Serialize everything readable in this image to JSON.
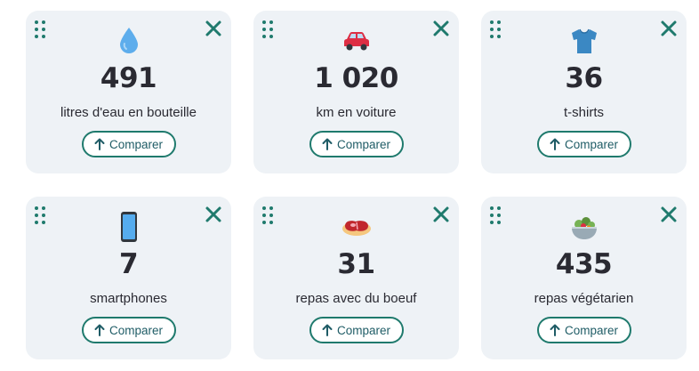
{
  "colors": {
    "accent": "#1f7a6d",
    "card_bg": "#eef2f6",
    "text": "#2a2a32"
  },
  "cards": [
    {
      "value": "491",
      "label": "litres d'eau en bouteille",
      "icon": "water-drop-icon",
      "button": "Comparer"
    },
    {
      "value": "1 020",
      "label": "km en voiture",
      "icon": "car-icon",
      "button": "Comparer"
    },
    {
      "value": "36",
      "label": "t-shirts",
      "icon": "tshirt-icon",
      "button": "Comparer"
    },
    {
      "value": "7",
      "label": "smartphones",
      "icon": "smartphone-icon",
      "button": "Comparer"
    },
    {
      "value": "31",
      "label": "repas avec du boeuf",
      "icon": "steak-icon",
      "button": "Comparer"
    },
    {
      "value": "435",
      "label": "repas végétarien",
      "icon": "salad-icon",
      "button": "Comparer"
    }
  ]
}
